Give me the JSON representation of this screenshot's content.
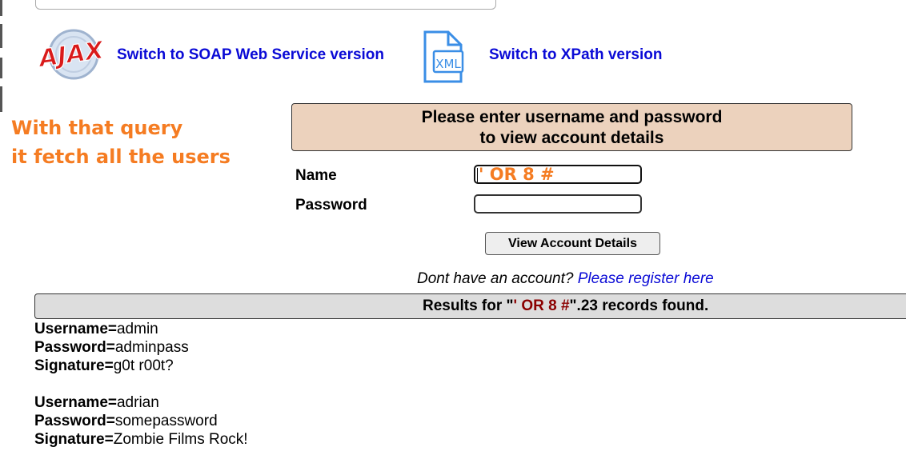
{
  "nav": {
    "soap_link": "Switch to SOAP Web Service version",
    "xpath_link": "Switch to XPath version",
    "ajax_logo_text": "AJAX",
    "xml_icon_text": "XML"
  },
  "annotation": {
    "line1": "With that query",
    "line2": "it fetch all the users"
  },
  "login": {
    "header_line1": "Please enter username and password",
    "header_line2": "to view account details",
    "name_label": "Name",
    "password_label": "Password",
    "name_value": "' OR 8 #",
    "password_value": "",
    "submit_label": "View Account Details"
  },
  "register": {
    "prompt": "Dont have an account?",
    "link": "Please register here"
  },
  "results": {
    "prefix": "Results for \"",
    "query": "' OR 8 #",
    "suffix": "\".23 records found."
  },
  "records": [
    {
      "username": "admin",
      "password": "adminpass",
      "signature": "g0t r00t?"
    },
    {
      "username": "adrian",
      "password": "somepassword",
      "signature": "Zombie Films Rock!"
    }
  ],
  "record_labels": {
    "username": "Username=",
    "password": "Password=",
    "signature": "Signature="
  },
  "colors": {
    "annotation": "#f57c22",
    "link": "#0a0ad6",
    "header_bg": "#ecd2bd",
    "results_bg": "#dddddd",
    "query_highlight": "#8b0000"
  }
}
